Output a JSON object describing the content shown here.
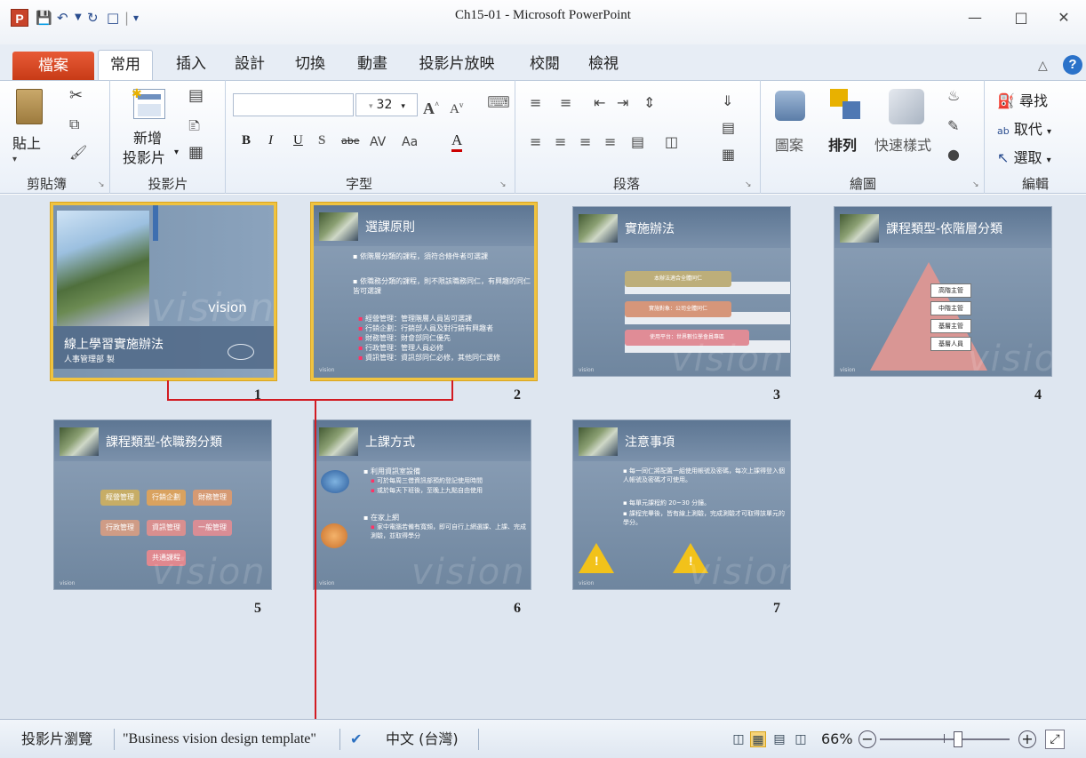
{
  "window": {
    "title": "Ch15-01 - Microsoft PowerPoint",
    "app_icon": "P",
    "minimize": "—",
    "maximize": "□",
    "close": "✕"
  },
  "tabs": [
    "檔案",
    "常用",
    "插入",
    "設計",
    "切換",
    "動畫",
    "投影片放映",
    "校閱",
    "檢視"
  ],
  "ribbon": {
    "paste_label": "貼上",
    "new_slide_label_1": "新增",
    "new_slide_label_2": "投影片",
    "font_size": "32",
    "bold": "B",
    "italic": "I",
    "underline": "U",
    "shadow": "S",
    "strike": "abe",
    "font_color": "A",
    "shapes_label": "圖案",
    "arrange_label": "排列",
    "quick_styles_label": "快速樣式",
    "find_label": "尋找",
    "replace_label": "取代",
    "select_label": "選取",
    "groups": [
      "剪貼簿",
      "投影片",
      "字型",
      "段落",
      "繪圖",
      "編輯"
    ]
  },
  "slides": [
    {
      "number": "1",
      "title": "線上學習實施辦法",
      "subtitle": "人事管理部 製",
      "watermark": "vision",
      "logo": "vision",
      "selected": true
    },
    {
      "number": "2",
      "title": "選課原則",
      "bullets": [
        "依階層分類的課程，須符合條件者可選課",
        "依職務分類的課程，則不限該職務同仁，有興趣的同仁皆可選課"
      ],
      "sub_bullets": [
        "經營管理：管理階層人員皆可選課",
        "行銷企劃：行銷部人員及對行銷有興趣者",
        "財務管理：財會部同仁優先",
        "行政管理：管理人員必修",
        "資訊管理：資訊部同仁必修，其他同仁選修"
      ],
      "footer": "vision",
      "selected": true
    },
    {
      "number": "3",
      "title": "實施辦法",
      "items": [
        "本辦法適合全體同仁",
        "實施對象：公司全體同仁",
        "使用平台：世界數位學會員專區"
      ],
      "watermark": "vision",
      "footer": "vision"
    },
    {
      "number": "4",
      "title": "課程類型-依階層分類",
      "levels": [
        "高階主管",
        "中階主管",
        "基層主管",
        "基層人員"
      ],
      "watermark": "vision",
      "footer": "vision"
    },
    {
      "number": "5",
      "title": "課程類型-依職務分類",
      "boxes": [
        "經營管理",
        "行銷企劃",
        "財務管理",
        "行政管理",
        "資訊管理",
        "一般管理",
        "共通課程"
      ],
      "watermark": "vision",
      "footer": "vision"
    },
    {
      "number": "6",
      "title": "上課方式",
      "bullets": [
        "利用資訊室設備",
        "在家上網"
      ],
      "sub_bullets_1": [
        "可於每周三借資訊部預約登記使用時間",
        "或於每天下班後，至晚上九點自由使用"
      ],
      "sub_bullets_2": [
        "家中電腦若備有寬頻，即可自行上網選課、上課、完成測驗，並取得學分"
      ],
      "watermark": "vision",
      "footer": "vision"
    },
    {
      "number": "7",
      "title": "注意事項",
      "bullets": [
        "每一同仁將配置一組使用帳號及密碼，每次上課得登入個人帳號及密碼才可使用。",
        "每單元課程約 20~30 分鐘。",
        "課程完畢後，皆有線上測驗，完成測驗才可取得該單元的學分。"
      ],
      "watermark": "vision",
      "footer": "vision"
    }
  ],
  "statusbar": {
    "view_name": "投影片瀏覽",
    "theme": "\"Business vision design template\"",
    "language": "中文 (台灣)",
    "zoom": "66%",
    "zoom_out": "−",
    "zoom_in": "+",
    "zoom_level": 0.6
  }
}
